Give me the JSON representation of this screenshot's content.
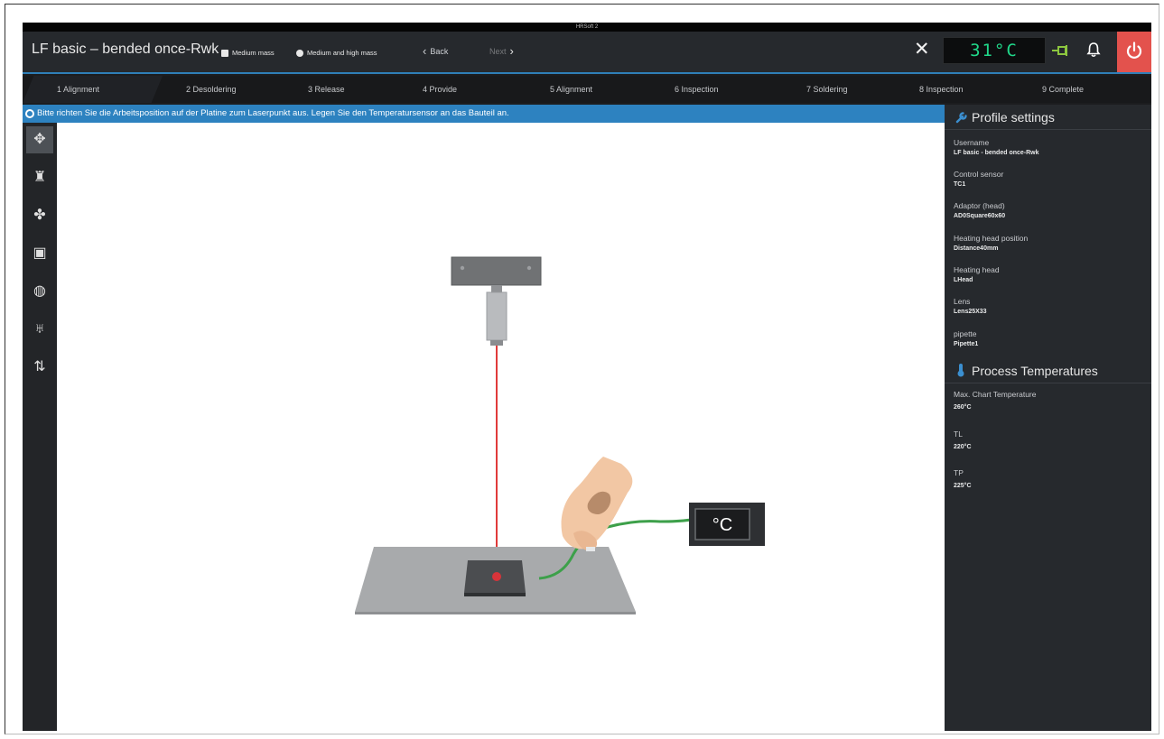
{
  "window_title": "HRSoft 2",
  "header": {
    "title": "LF basic – bended once-Rwk",
    "mass_options": [
      "Medium mass",
      "Medium and high mass"
    ],
    "back_label": "Back",
    "next_label": "Next",
    "temperature": "31°C",
    "colors": {
      "accent": "#2d82c0",
      "power": "#e3524d",
      "temp_digits": "#20d88a",
      "sensor": "#8cc63f"
    }
  },
  "steps": [
    "1 Alignment",
    "2 Desoldering",
    "3 Release",
    "4 Provide",
    "5 Alignment",
    "6 Inspection",
    "7 Soldering",
    "8 Inspection",
    "9 Complete"
  ],
  "active_step": 0,
  "banner": "Bitte richten Sie die Arbeitsposition auf der Platine zum Laserpunkt aus. Legen Sie den Temperatursensor an das Bauteil an.",
  "tools": [
    "crosshair-icon",
    "heater-icon",
    "fan-icon",
    "image-icon",
    "chip-icon",
    "nozzle-icon",
    "swap-icon"
  ],
  "profile": {
    "heading": "Profile settings",
    "fields": [
      {
        "label": "Username",
        "value": "LF basic - bended once-Rwk"
      },
      {
        "label": "Control sensor",
        "value": "TC1"
      },
      {
        "label": "Adaptor (head)",
        "value": "AD0Square60x60"
      },
      {
        "label": "Heating head position",
        "value": "Distance40mm"
      },
      {
        "label": "Heating head",
        "value": "LHead"
      },
      {
        "label": "Lens",
        "value": "Lens25X33"
      },
      {
        "label": "pipette",
        "value": "Pipette1"
      }
    ]
  },
  "process": {
    "heading": "Process Temperatures",
    "fields": [
      {
        "label": "Max. Chart Temperature",
        "value": "260°C"
      },
      {
        "label": "TL",
        "value": "220°C"
      },
      {
        "label": "TP",
        "value": "225°C"
      }
    ]
  },
  "illustration": {
    "sensor_display": "°C"
  }
}
